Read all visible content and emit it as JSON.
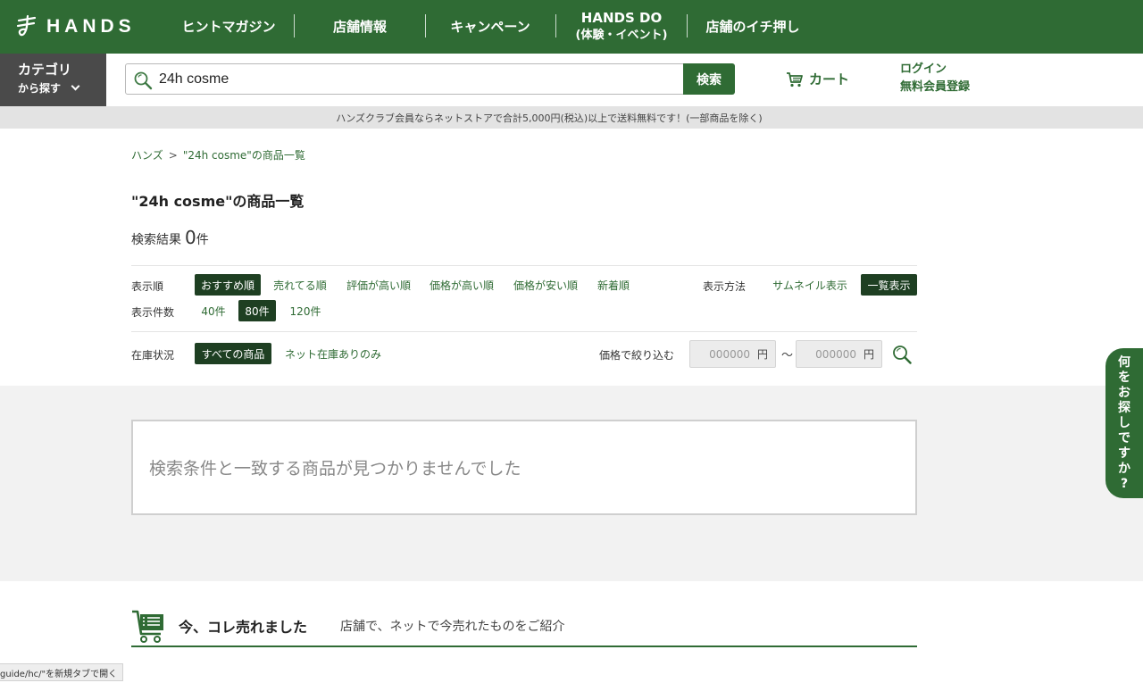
{
  "header": {
    "logo_text": "HANDS",
    "nav": [
      {
        "label": "ヒントマガジン"
      },
      {
        "label": "店舗情報"
      },
      {
        "label": "キャンペーン"
      },
      {
        "label": "HANDS DO",
        "sub": "(体験・イベント)"
      },
      {
        "label": "店舗のイチ押し"
      }
    ]
  },
  "category": {
    "line1": "カテゴリ",
    "line2": "から探す"
  },
  "search": {
    "value": "24h cosme",
    "button": "検索"
  },
  "cart": {
    "label": "カート"
  },
  "account": {
    "login": "ログイン",
    "register": "無料会員登録"
  },
  "notice": "ハンズクラブ会員ならネットストアで合計5,000円(税込)以上で送料無料です！(一部商品を除く)",
  "breadcrumb": {
    "home": "ハンズ",
    "sep": ">",
    "current": "\"24h cosme\"の商品一覧"
  },
  "page_title": "\"24h cosme\"の商品一覧",
  "results": {
    "label": "検索結果",
    "count": "0",
    "unit": "件"
  },
  "sort": {
    "label": "表示順",
    "options": [
      "おすすめ順",
      "売れてる順",
      "評価が高い順",
      "価格が高い順",
      "価格が安い順",
      "新着順"
    ],
    "active": "おすすめ順"
  },
  "view": {
    "label": "表示方法",
    "options": [
      "サムネイル表示",
      "一覧表示"
    ],
    "active": "一覧表示"
  },
  "per_page": {
    "label": "表示件数",
    "options": [
      "40件",
      "80件",
      "120件"
    ],
    "active": "80件"
  },
  "stock": {
    "label": "在庫状況",
    "options": [
      "すべての商品",
      "ネット在庫ありのみ"
    ],
    "active": "すべての商品"
  },
  "price_filter": {
    "label": "価格で絞り込む",
    "min_placeholder": "000000",
    "max_placeholder": "000000",
    "currency": "円",
    "tilde": "〜"
  },
  "empty_message": "検索条件と一致する商品が見つかりませんでした",
  "sold_section": {
    "title": "今、コレ売れました",
    "subtitle": "店舗で、ネットで今売れたものをご紹介"
  },
  "side_tab": {
    "chars": [
      "何",
      "を",
      "お",
      "探",
      "し",
      "で",
      "す",
      "か",
      "?"
    ]
  },
  "status_tooltip": "guide/hc/\"を新規タブで開く",
  "colors": {
    "brand_green": "#2f6b34",
    "dark_green": "#1e3f22",
    "category_bg": "#4a4a4a"
  }
}
